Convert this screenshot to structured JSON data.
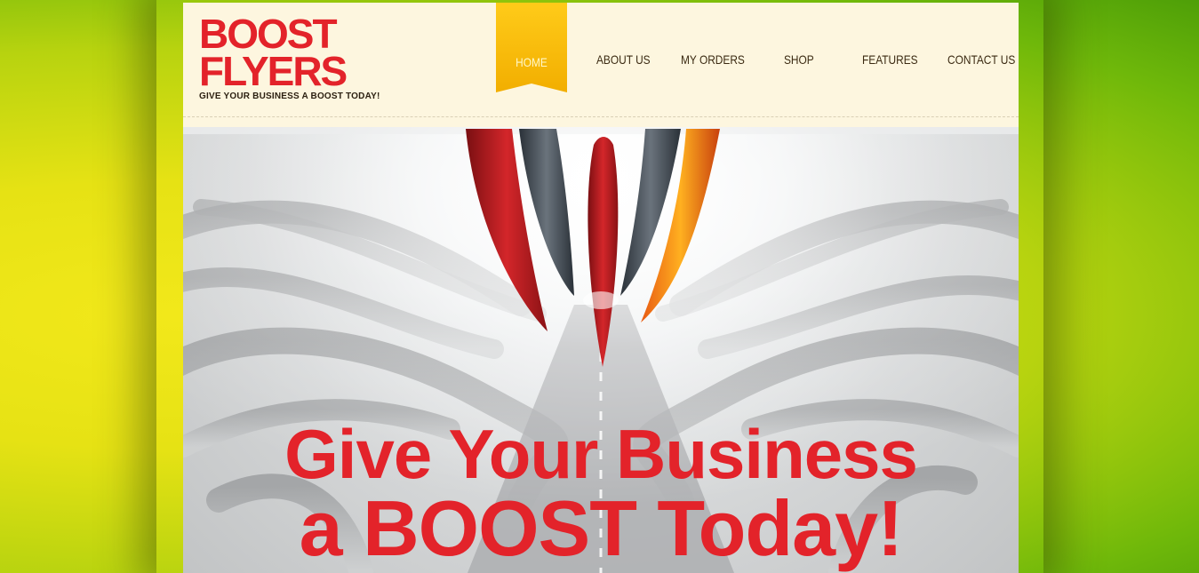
{
  "brand": {
    "line1": "BOOST",
    "line2": "FLYERS",
    "tagline": "GIVE YOUR BUSINESS A BOOST TODAY!",
    "color": "#e3232a"
  },
  "nav": {
    "active_color": "#f6b900",
    "items": [
      {
        "label": "HOME",
        "active": true
      },
      {
        "label": "ABOUT US",
        "active": false
      },
      {
        "label": "MY ORDERS",
        "active": false
      },
      {
        "label": "SHOP",
        "active": false
      },
      {
        "label": "FEATURES",
        "active": false
      },
      {
        "label": "CONTACT US",
        "active": false
      }
    ]
  },
  "hero": {
    "headline_line1": "Give Your Business",
    "headline_line2": "a BOOST Today!"
  },
  "colors": {
    "background_green": "#6fb80a",
    "background_yellow": "#f2e81a",
    "page_cream": "#fdf6df"
  }
}
